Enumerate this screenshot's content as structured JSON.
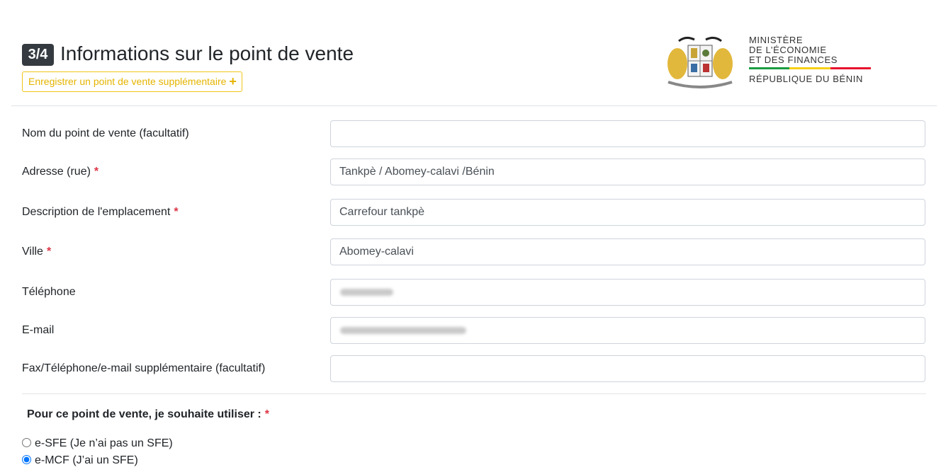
{
  "header": {
    "step": "3/4",
    "title": "Informations sur le point de vente",
    "add_button_label": "Enregistrer un point de vente supplémentaire",
    "add_button_icon": "plus-icon",
    "ministry_lines": [
      "MINISTÈRE",
      "DE L’ÉCONOMIE",
      "ET DES FINANCES"
    ],
    "republic": "RÉPUBLIQUE DU BÉNIN",
    "flag_colors": [
      "#1a9c41",
      "#f7d117",
      "#e8112d"
    ],
    "emblem_icon": "benin-coat-of-arms"
  },
  "form": {
    "fields": [
      {
        "label": "Nom du point de vente (facultatif)",
        "value": "",
        "required": false
      },
      {
        "label": "Adresse (rue)",
        "value": "Tankpè / Abomey-calavi /Bénin",
        "required": true
      },
      {
        "label": "Description de l'emplacement",
        "value": "Carrefour tankpè",
        "required": true
      },
      {
        "label": "Ville",
        "value": "Abomey-calavi",
        "required": true
      },
      {
        "label": "Téléphone",
        "value": "",
        "required": false
      },
      {
        "label": "E-mail",
        "value": "",
        "required": false
      },
      {
        "label": "Fax/Téléphone/e-mail supplémentaire (facultatif)",
        "value": "",
        "required": false
      }
    ],
    "required_mark": "*"
  },
  "choice": {
    "question": "Pour ce point de vente, je souhaite utiliser :",
    "options": [
      {
        "label": "e-SFE (Je n’ai pas un SFE)",
        "checked": false
      },
      {
        "label": "e-MCF (J’ai un SFE)",
        "checked": true
      }
    ]
  },
  "colors": {
    "accent": "#f0c419",
    "required": "#dc3545",
    "badge": "#343a40"
  }
}
